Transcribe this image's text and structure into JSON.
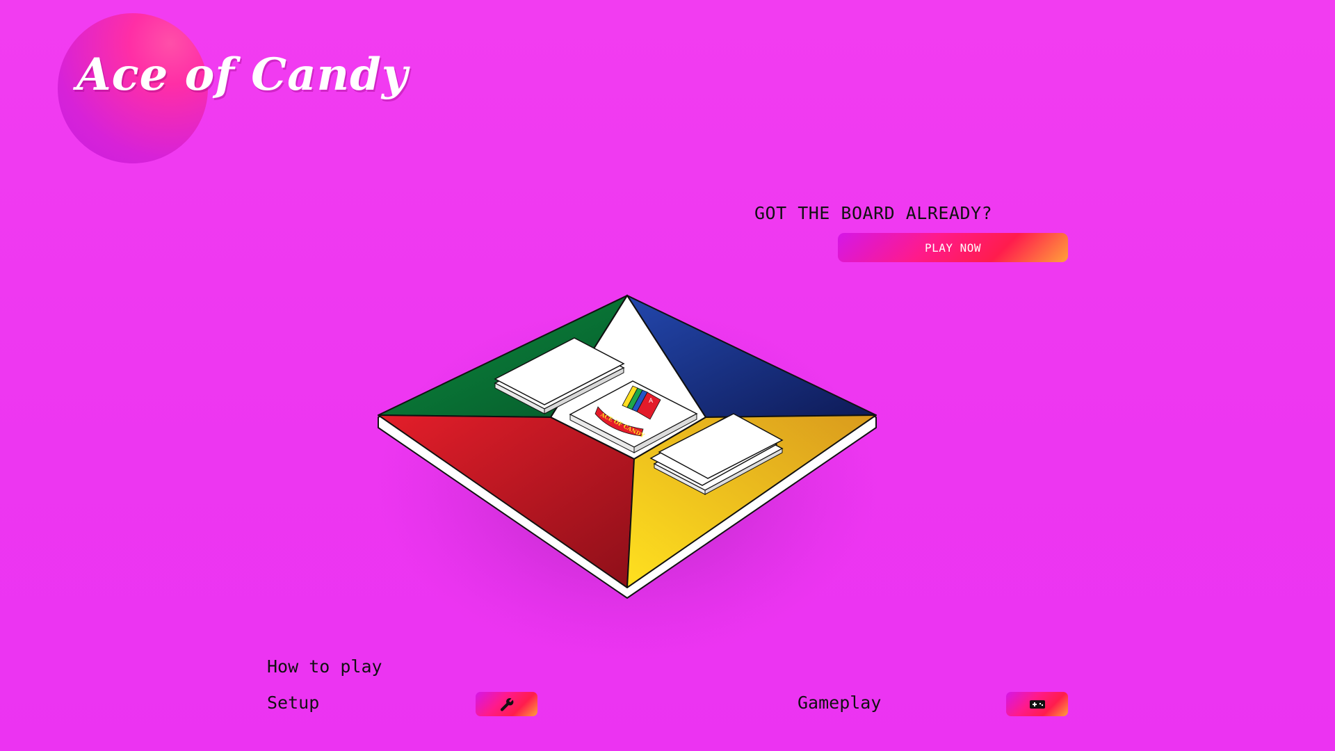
{
  "app": {
    "title": "Ace of Candy"
  },
  "colors": {
    "background": "#f03bf1",
    "accent_gradient_start": "#d417e8",
    "accent_gradient_mid": "#ff1c4d",
    "accent_gradient_end": "#ffa23a",
    "board_green": "#0b7a3a",
    "board_blue": "#1f3fa0",
    "board_red": "#e61d2b",
    "board_yellow": "#f7c21e"
  },
  "cta": {
    "heading": "GOT THE BOARD ALREADY?",
    "button_label": "PLAY NOW"
  },
  "board": {
    "quadrants": [
      "green",
      "blue",
      "red",
      "yellow"
    ],
    "center_card_label": "ACE OF CANDY",
    "center_card_corner_letter": "A",
    "stacks": [
      "draw-pile",
      "discard-pile"
    ]
  },
  "how_to_play": {
    "title": "How to play",
    "sections": [
      {
        "label": "Setup",
        "icon": "wrench-icon"
      },
      {
        "label": "Gameplay",
        "icon": "gamepad-icon"
      }
    ]
  }
}
